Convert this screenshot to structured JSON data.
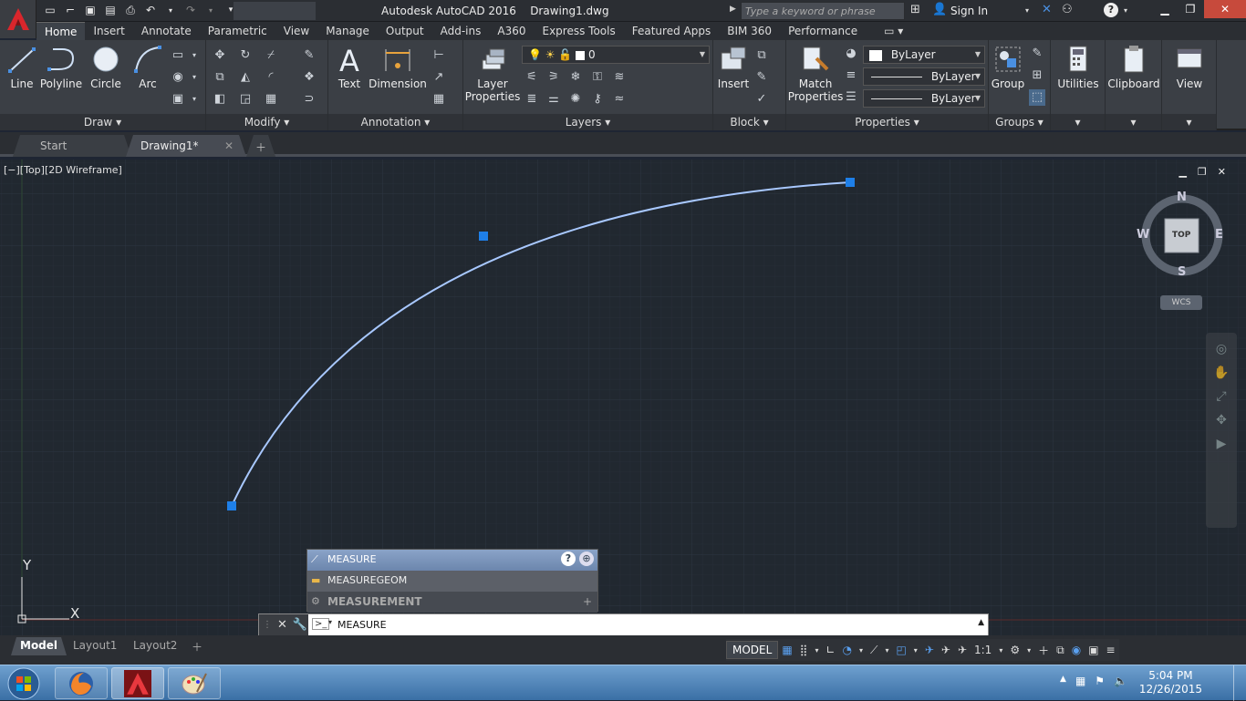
{
  "window": {
    "title": "Autodesk AutoCAD 2016",
    "document": "Drawing1.dwg",
    "search_placeholder": "Type a keyword or phrase",
    "sign_in": "Sign In",
    "help": "?"
  },
  "ribbon_tabs": [
    "Home",
    "Insert",
    "Annotate",
    "Parametric",
    "View",
    "Manage",
    "Output",
    "Add-ins",
    "A360",
    "Express Tools",
    "Featured Apps",
    "BIM 360",
    "Performance"
  ],
  "panels": {
    "draw": {
      "title": "Draw",
      "tools": [
        "Line",
        "Polyline",
        "Circle",
        "Arc"
      ]
    },
    "modify": {
      "title": "Modify"
    },
    "annotation": {
      "title": "Annotation",
      "tools": [
        "Text",
        "Dimension"
      ]
    },
    "layers": {
      "title": "Layers",
      "tool": "Layer Properties",
      "current_layer": "0"
    },
    "block": {
      "title": "Block",
      "tool": "Insert"
    },
    "properties": {
      "title": "Properties",
      "tool": "Match Properties",
      "color": "ByLayer",
      "linetype": "ByLayer",
      "lineweight": "ByLayer"
    },
    "groups": {
      "title": "Groups",
      "tool": "Group"
    },
    "utilities": {
      "title": "Utilities"
    },
    "clipboard": {
      "title": "Clipboard"
    },
    "view": {
      "title": "View"
    }
  },
  "file_tabs": [
    "Start",
    "Drawing1*"
  ],
  "viewport": {
    "label": "[−][Top][2D Wireframe]",
    "viewcube": {
      "north": "N",
      "south": "S",
      "east": "E",
      "west": "W",
      "face": "TOP",
      "ucs": "WCS"
    },
    "ucs_axes": {
      "y": "Y",
      "x": "X"
    }
  },
  "autocomplete": {
    "rows": [
      "MEASURE",
      "MEASUREGEOM",
      "MEASUREMENT"
    ]
  },
  "command_line": {
    "input": "MEASURE"
  },
  "layout_tabs": [
    "Model",
    "Layout1",
    "Layout2"
  ],
  "status_bar": {
    "model": "MODEL",
    "scale": "1:1"
  },
  "taskbar": {
    "time": "5:04 PM",
    "date": "12/26/2015"
  },
  "colors": {
    "background": "#212830",
    "arc": "#a8c8ff",
    "grip": "#1e7fe8",
    "ribbon": "#3b3f45"
  }
}
